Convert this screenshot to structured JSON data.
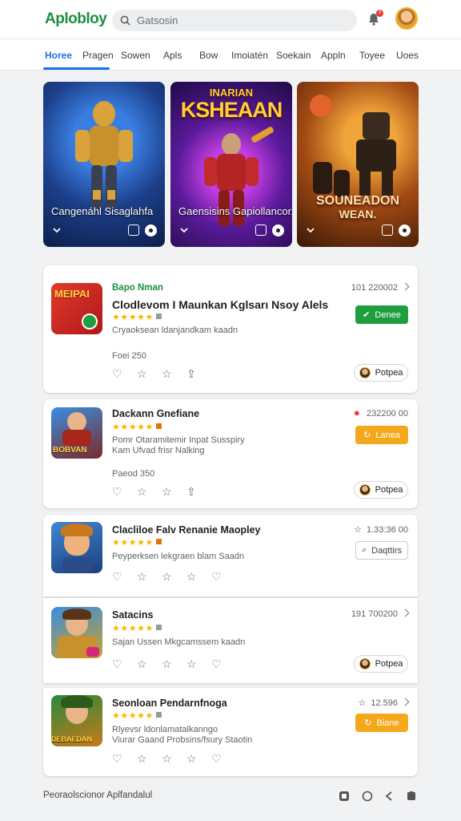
{
  "header": {
    "logo": "Aplobloy",
    "search_placeholder": "Gatsosin",
    "notification_count": "3"
  },
  "tabs": [
    "Horee",
    "Pragen",
    "Sowen",
    "Apls",
    "Bow",
    "Imoiatén",
    "Soekain",
    "Appln",
    "Toyee",
    "Uoes"
  ],
  "banners": [
    {
      "title": "Cangenáhl Sisaglahfa"
    },
    {
      "title": "Gaensisins Gapiollancor.",
      "art_title_top": "INARIAN",
      "art_title": "KSHEAAN"
    },
    {
      "title": "",
      "art_title": "SOUNEADON",
      "art_subtitle": "WEAN."
    }
  ],
  "apps": [
    {
      "developer": "Bapo Nman",
      "name": "Clodlevom I Maunkan Kglsarı Nsoy Alels",
      "desc": [
        "Cryaoksean ldanjandkam kaadn"
      ],
      "price": "Foei 250",
      "meta": "101 220002",
      "button": "Denee",
      "profile_button": "Potpea",
      "icon_text": "MEIPAI"
    },
    {
      "name": "Dackann Gnefiane",
      "desc": [
        "Pomr Otaramitemir Inpat Susspiry",
        "Kam Ufvad frisr Nalking"
      ],
      "price": "Paeod 350",
      "meta": "232200 00",
      "button": "Lanea",
      "profile_button": "Potpea",
      "icon_text": "BOBVAN"
    },
    {
      "name": "Clacliloe Falv Renanie Maopley",
      "desc": [
        "Peyperksen lekgraen blam Saadn"
      ],
      "meta": "1.33:36 00",
      "button": "Daqttirs"
    },
    {
      "name": "Satacins",
      "desc": [
        "Sajan Ussen Mkgcamssem kaadn"
      ],
      "meta": "191 700200",
      "profile_button": "Potpea"
    },
    {
      "name": "Seonloan Pendarnfnoga",
      "desc": [
        "Rlyevsr ldonlamatalkanngo",
        "Viurar Gaand Probsins/fsury Staotin"
      ],
      "meta": "12.596",
      "button": "Biane",
      "icon_text": "DEBAEDAN"
    }
  ],
  "stars": "★★★★★",
  "footer": {
    "text": "Peoraolscionor Aplfandalul"
  },
  "colors": {
    "accent": "#1a73e8",
    "brand": "#1e8e3e",
    "install": "#1e9e3e",
    "update": "#f4a91c",
    "stars": "#f9b400"
  }
}
